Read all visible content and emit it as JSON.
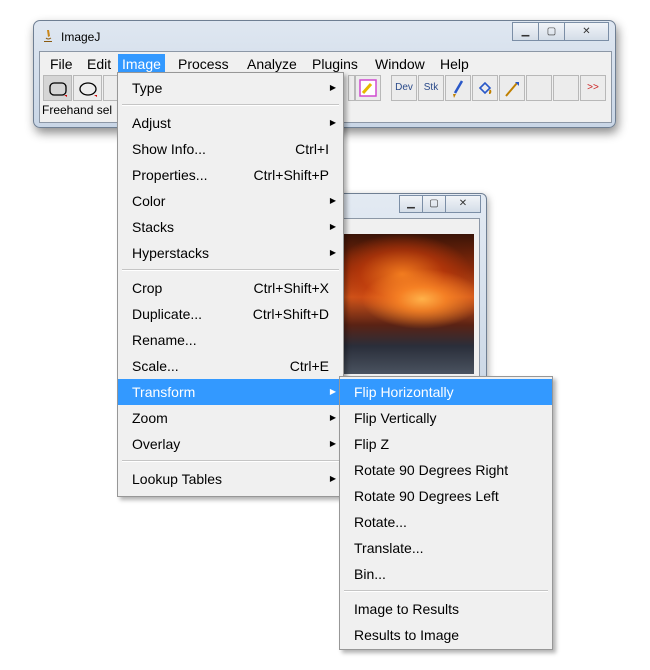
{
  "app": {
    "title": "ImageJ"
  },
  "menubar": [
    "File",
    "Edit",
    "Image",
    "Process",
    "Analyze",
    "Plugins",
    "Window",
    "Help"
  ],
  "toolbar": {
    "dev": "Dev",
    "stk": "Stk",
    "more": ">>"
  },
  "status": "Freehand sel",
  "image_menu": {
    "items": [
      {
        "label": "Type",
        "shortcut": "",
        "submenu": true
      },
      {
        "label": "Adjust",
        "shortcut": "",
        "submenu": true
      },
      {
        "label": "Show Info...",
        "shortcut": "Ctrl+I",
        "submenu": false
      },
      {
        "label": "Properties...",
        "shortcut": "Ctrl+Shift+P",
        "submenu": false
      },
      {
        "label": "Color",
        "shortcut": "",
        "submenu": true
      },
      {
        "label": "Stacks",
        "shortcut": "",
        "submenu": true
      },
      {
        "label": "Hyperstacks",
        "shortcut": "",
        "submenu": true
      },
      {
        "label": "Crop",
        "shortcut": "Ctrl+Shift+X",
        "submenu": false
      },
      {
        "label": "Duplicate...",
        "shortcut": "Ctrl+Shift+D",
        "submenu": false
      },
      {
        "label": "Rename...",
        "shortcut": "",
        "submenu": false
      },
      {
        "label": "Scale...",
        "shortcut": "Ctrl+E",
        "submenu": false
      },
      {
        "label": "Transform",
        "shortcut": "",
        "submenu": true,
        "highlighted": true
      },
      {
        "label": "Zoom",
        "shortcut": "",
        "submenu": true
      },
      {
        "label": "Overlay",
        "shortcut": "",
        "submenu": true
      },
      {
        "label": "Lookup Tables",
        "shortcut": "",
        "submenu": true
      }
    ]
  },
  "transform_menu": {
    "items": [
      {
        "label": "Flip Horizontally",
        "highlighted": true
      },
      {
        "label": "Flip Vertically"
      },
      {
        "label": "Flip Z"
      },
      {
        "label": "Rotate 90 Degrees Right"
      },
      {
        "label": "Rotate 90 Degrees Left"
      },
      {
        "label": "Rotate..."
      },
      {
        "label": "Translate..."
      },
      {
        "label": "Bin..."
      },
      {
        "label": "Image to Results"
      },
      {
        "label": "Results to Image"
      }
    ]
  },
  "colors": {
    "highlight": "#3399ff",
    "menu_bg": "#f0f0f0"
  }
}
